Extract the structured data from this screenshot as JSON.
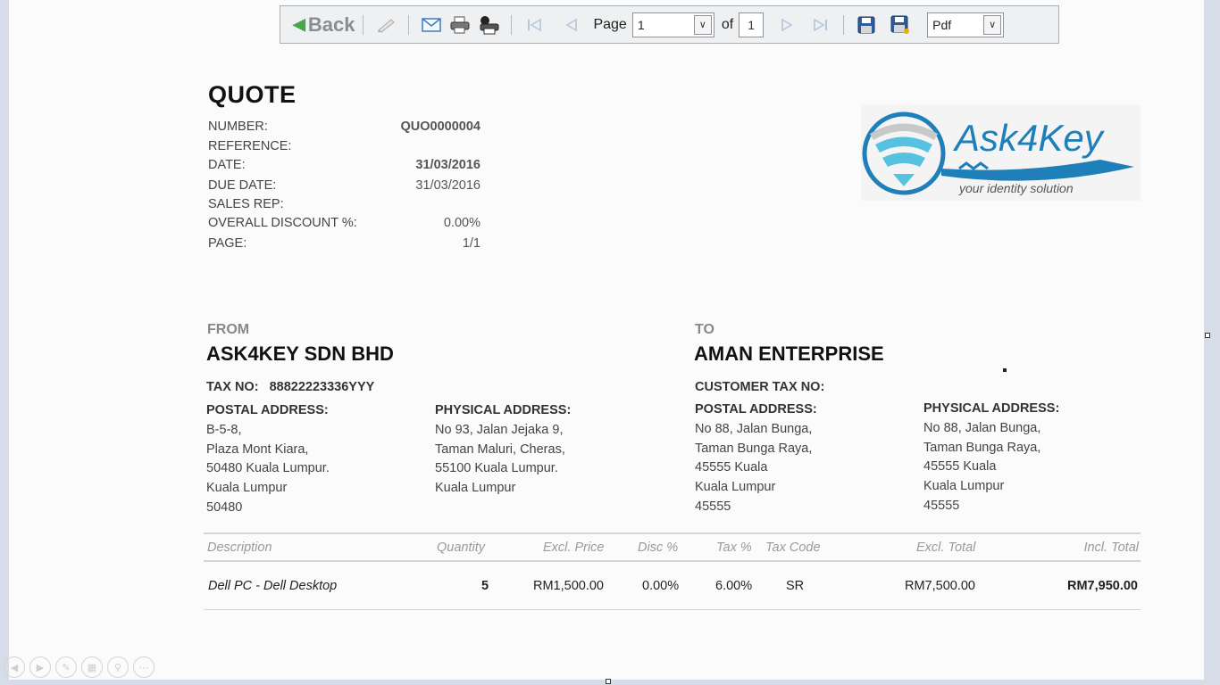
{
  "toolbar": {
    "back_label": "Back",
    "page_label": "Page",
    "page_value": "1",
    "of_label": "of",
    "page_count": "1",
    "format_value": "Pdf",
    "icons": [
      "back-arrow-icon",
      "edit-icon",
      "email-icon",
      "print-icon",
      "print-setup-icon",
      "first-page-icon",
      "prev-page-icon",
      "next-page-icon",
      "last-page-icon",
      "save-icon",
      "save-as-icon"
    ]
  },
  "quote": {
    "title": "QUOTE",
    "fields": [
      {
        "label": "NUMBER:",
        "value": "QUO0000004"
      },
      {
        "label": "REFERENCE:",
        "value": ""
      },
      {
        "label": "DATE:",
        "value": "31/03/2016"
      },
      {
        "label": "DUE DATE:",
        "value": "31/03/2016"
      },
      {
        "label": "SALES REP:",
        "value": ""
      },
      {
        "label": "OVERALL DISCOUNT %:",
        "value": "0.00%"
      },
      {
        "label": "PAGE:",
        "value": "1/1"
      }
    ]
  },
  "logo": {
    "brand": "Ask4Key",
    "tagline": "your identity solution",
    "colors": {
      "blue": "#1f7fb8",
      "light_blue": "#57c2e0",
      "grey": "#c8c8c8"
    }
  },
  "from": {
    "section_label": "FROM",
    "name": "ASK4KEY SDN BHD",
    "tax_label": "TAX NO:",
    "tax_value": "88822223336YYY",
    "postal_header": "POSTAL ADDRESS:",
    "postal": [
      "B-5-8,",
      "Plaza Mont Kiara,",
      "50480 Kuala Lumpur.",
      "Kuala Lumpur",
      "50480"
    ],
    "physical_header": "PHYSICAL ADDRESS:",
    "physical": [
      "No 93, Jalan Jejaka 9,",
      "Taman Maluri, Cheras,",
      "55100 Kuala Lumpur.",
      "Kuala Lumpur"
    ]
  },
  "to": {
    "section_label": "TO",
    "name": "AMAN ENTERPRISE",
    "tax_label": "CUSTOMER TAX NO:",
    "tax_value": "",
    "postal_header": "POSTAL ADDRESS:",
    "postal": [
      "No 88, Jalan Bunga,",
      "Taman Bunga Raya,",
      "45555 Kuala",
      "Kuala Lumpur",
      "45555"
    ],
    "physical_header": "PHYSICAL ADDRESS:",
    "physical": [
      "No 88, Jalan Bunga,",
      "Taman Bunga Raya,",
      "45555 Kuala",
      "Kuala Lumpur",
      "45555"
    ]
  },
  "table": {
    "headers": {
      "description": "Description",
      "quantity": "Quantity",
      "excl_price": "Excl. Price",
      "disc": "Disc %",
      "tax": "Tax %",
      "tax_code": "Tax Code",
      "excl_total": "Excl. Total",
      "incl_total": "Incl. Total"
    },
    "rows": [
      {
        "description": "Dell PC - Dell Desktop",
        "quantity": "5",
        "excl_price": "RM1,500.00",
        "disc": "0.00%",
        "tax": "6.00%",
        "tax_code": "SR",
        "excl_total": "RM7,500.00",
        "incl_total": "RM7,950.00"
      }
    ]
  }
}
